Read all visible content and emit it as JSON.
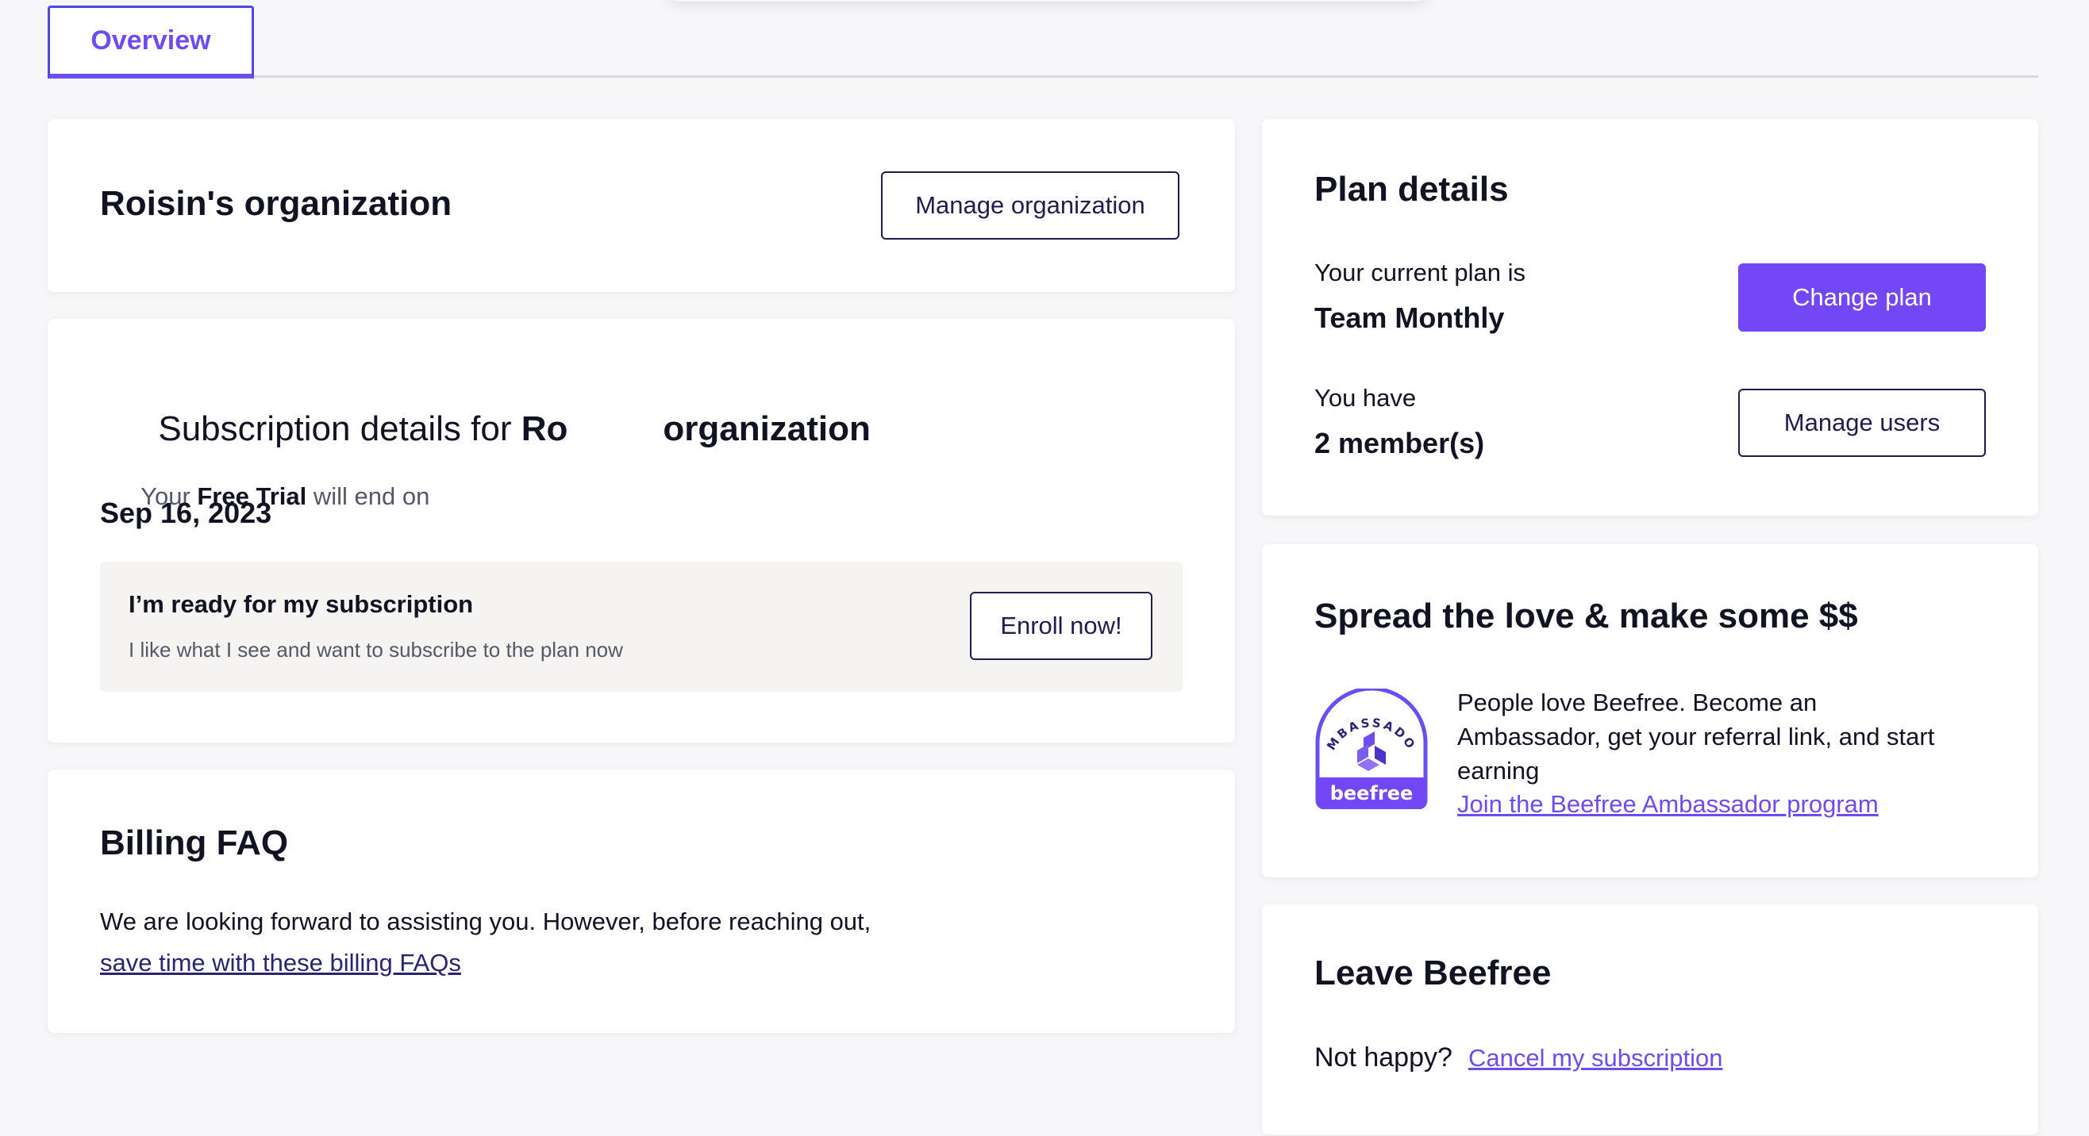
{
  "tabs": {
    "overview": "Overview"
  },
  "org_card": {
    "title": "Roisin's organization",
    "manage_button": "Manage organization"
  },
  "subscription": {
    "title_prefix": "Subscription details for ",
    "title_bold_start": "Ro",
    "title_bold_end": "organization",
    "trial_prefix": "Your ",
    "trial_plan": "Free Trial",
    "trial_suffix": " will end on",
    "end_date": "Sep 16, 2023",
    "ready_title": "I’m ready for my subscription",
    "ready_desc": "I like what I see and want to subscribe to the plan now",
    "enroll_button": "Enroll now!"
  },
  "faq": {
    "title": "Billing FAQ",
    "text": "We are looking forward to assisting you. However, before reaching out,",
    "link": "save time with these billing FAQs"
  },
  "plan": {
    "title": "Plan details",
    "current_label": "Your current plan is",
    "current_value": "Team Monthly",
    "change_button": "Change plan",
    "members_label": "You have",
    "members_value": "2 member(s)",
    "manage_users_button": "Manage users"
  },
  "ambassador": {
    "title": "Spread the love & make some $$",
    "text_line1": "People love Beefree. Become an",
    "text_line2": "Ambassador, get your referral link, and start",
    "text_line3": "earning",
    "link": "Join the Beefree Ambassador program",
    "badge_top_text": "AMBASSADOR",
    "badge_bottom_text": "beefree"
  },
  "leave": {
    "title": "Leave Beefree",
    "prompt": "Not happy?",
    "link": "Cancel my subscription"
  },
  "colors": {
    "accent": "#7347f5",
    "link": "#6b4ef0",
    "navy": "#1f1d4d"
  }
}
